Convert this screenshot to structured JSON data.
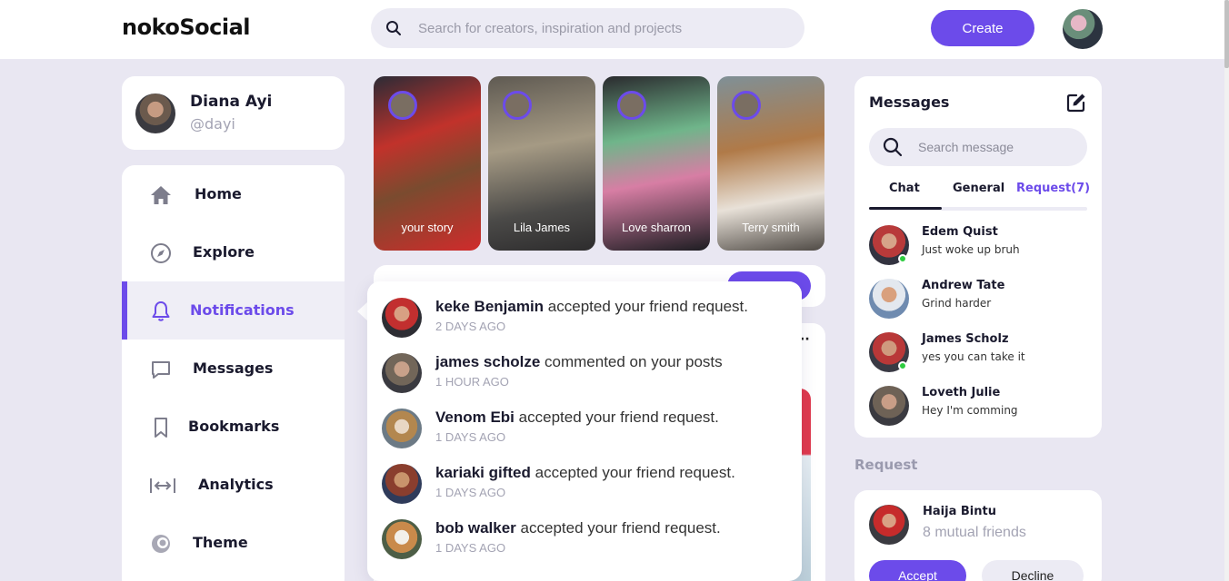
{
  "app": {
    "logo": "nokoSocial"
  },
  "header": {
    "search_placeholder": "Search for creators, inspiration and projects",
    "create_label": "Create"
  },
  "profile": {
    "name": "Diana Ayi",
    "handle": "@dayi"
  },
  "sidebar": {
    "items": [
      {
        "label": "Home",
        "icon": "home-icon"
      },
      {
        "label": "Explore",
        "icon": "compass-icon"
      },
      {
        "label": "Notifications",
        "icon": "bell-icon",
        "active": true
      },
      {
        "label": "Messages",
        "icon": "chat-bubble-icon"
      },
      {
        "label": "Bookmarks",
        "icon": "bookmark-icon"
      },
      {
        "label": "Analytics",
        "icon": "analytics-icon"
      },
      {
        "label": "Theme",
        "icon": "palette-icon"
      }
    ]
  },
  "stories": [
    {
      "name": "your story"
    },
    {
      "name": "Lila James"
    },
    {
      "name": "Love sharron"
    },
    {
      "name": "Terry smith"
    }
  ],
  "notifications": [
    {
      "user": "keke Benjamin",
      "action": "accepted your friend request.",
      "time": "2 DAYS AGO"
    },
    {
      "user": "james scholze",
      "action": "commented on your posts",
      "time": "1 HOUR AGO"
    },
    {
      "user": "Venom Ebi",
      "action": "accepted your friend request.",
      "time": "1 DAYS AGO"
    },
    {
      "user": "kariaki gifted",
      "action": "accepted your friend request.",
      "time": "1 DAYS AGO"
    },
    {
      "user": "bob walker",
      "action": "accepted your friend request.",
      "time": "1 DAYS AGO"
    }
  ],
  "messages": {
    "title": "Messages",
    "search_placeholder": "Search message",
    "tabs": [
      {
        "label": "Chat",
        "active": true
      },
      {
        "label": "General"
      },
      {
        "label": "Request(7)"
      }
    ],
    "chats": [
      {
        "name": "Edem Quist",
        "preview": "Just woke up bruh",
        "online": true
      },
      {
        "name": "Andrew Tate",
        "preview": "Grind harder",
        "online": false
      },
      {
        "name": "James Scholz",
        "preview": "yes you can take it",
        "online": true
      },
      {
        "name": "Loveth Julie",
        "preview": "Hey I'm comming",
        "online": false
      }
    ]
  },
  "requests": {
    "heading": "Request",
    "items": [
      {
        "name": "Haija Bintu",
        "mutual": "8 mutual friends",
        "accept_label": "Accept",
        "decline_label": "Decline"
      }
    ]
  },
  "colors": {
    "accent": "#6c4bea",
    "background": "#e9e7f2",
    "online": "#2ecc40"
  }
}
